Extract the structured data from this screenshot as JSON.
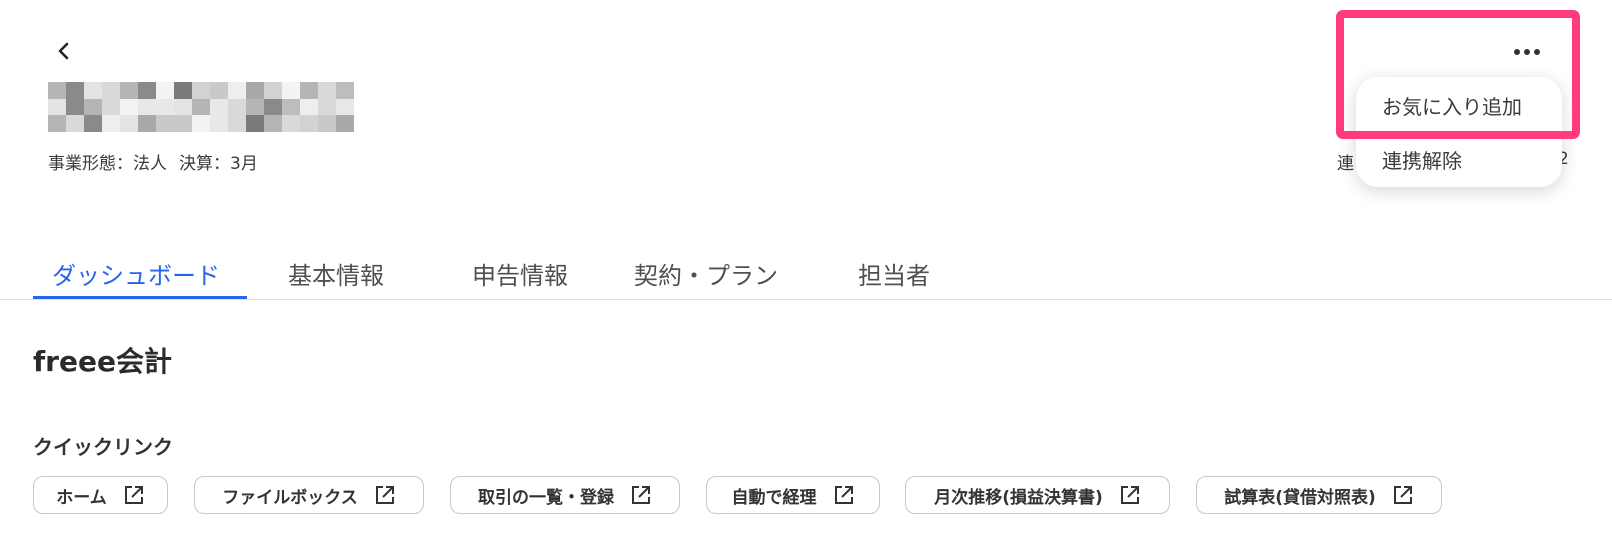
{
  "header": {
    "business_info": "事業形態：法人",
    "settlement_info": "決算：3月",
    "right_info_visible": "連",
    "right_info_tail": "2"
  },
  "menu": {
    "favorite_label": "お気に入り追加",
    "unlink_label": "連携解除"
  },
  "tabs": [
    {
      "label": "ダッシュボード",
      "active": true
    },
    {
      "label": "基本情報",
      "active": false
    },
    {
      "label": "申告情報",
      "active": false
    },
    {
      "label": "契約・プラン",
      "active": false
    },
    {
      "label": "担当者",
      "active": false
    }
  ],
  "section": {
    "title": "freee会計",
    "quick_links_title": "クイックリンク"
  },
  "quick_links": [
    {
      "label": "ホーム",
      "icon": "external-link-icon"
    },
    {
      "label": "ファイルボックス",
      "icon": "external-link-icon"
    },
    {
      "label": "取引の一覧・登録",
      "icon": "external-link-icon"
    },
    {
      "label": "自動で経理",
      "icon": "external-link-icon"
    },
    {
      "label": "月次推移(損益決算書)",
      "icon": "external-link-icon"
    },
    {
      "label": "試算表(貸借対照表)",
      "icon": "external-link-icon"
    }
  ],
  "colors": {
    "accent": "#2864f0",
    "highlight": "#ff3b7b",
    "text": "#2b2b2b"
  },
  "icons": {
    "back": "chevron-left-icon",
    "more": "more-horizontal-icon",
    "link": "external-link-icon"
  }
}
